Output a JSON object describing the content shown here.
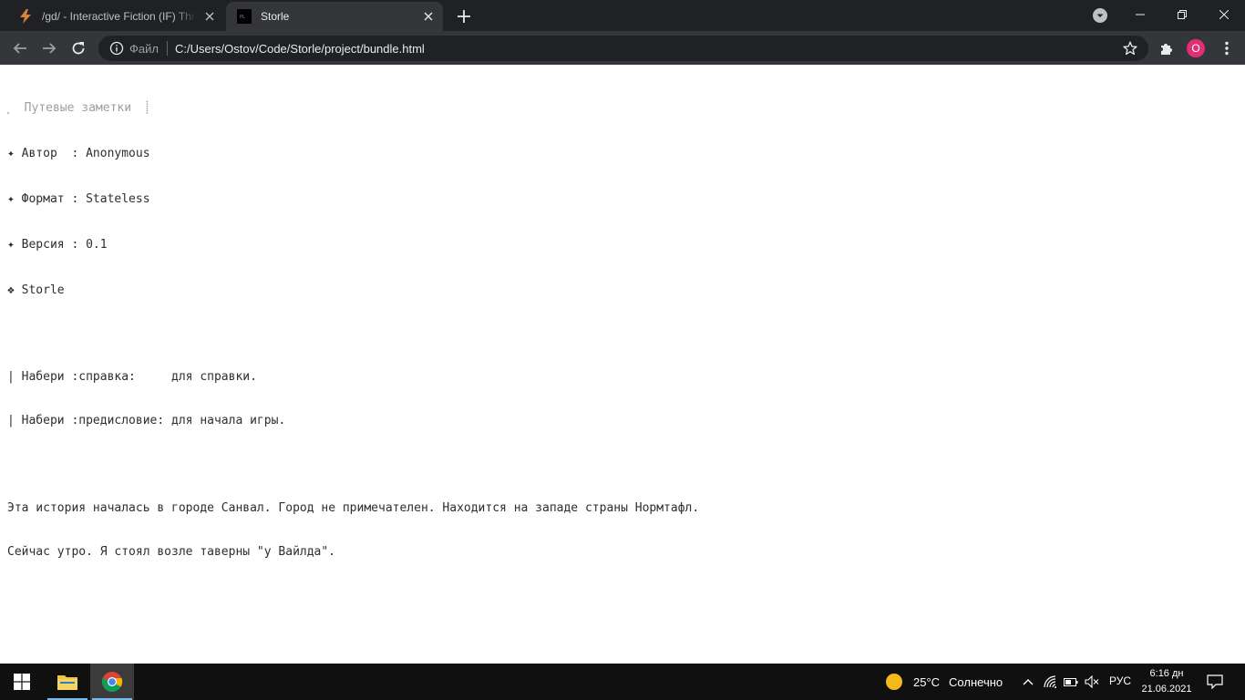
{
  "browser": {
    "tabs": [
      {
        "title": "/gd/ - Interactive Fiction (IF) Thre",
        "favicon": "lightning-icon",
        "active": false
      },
      {
        "title": "Storle",
        "favicon": "terminal-icon",
        "active": true
      }
    ],
    "new_tab_icon": "plus-icon",
    "profile_menu_icon": "chevron-down-icon",
    "window_controls": [
      "minimize-icon",
      "restore-icon",
      "close-icon"
    ],
    "toolbar": {
      "back_icon": "arrow-left-icon",
      "forward_icon": "arrow-right-icon",
      "reload_icon": "reload-icon",
      "scheme_label": "Файл",
      "url": "C:/Users/Ostov/Code/Storle/project/bundle.html",
      "bookmark_icon": "star-icon",
      "extensions_icon": "puzzle-icon",
      "avatar_letter": "O",
      "avatar_color": "#e52f75",
      "menu_icon": "kebab-icon"
    }
  },
  "page": {
    "header_title": "⸼  Путевые заметки  ⸽",
    "meta": [
      "✦ Автор  : Anonymous",
      "✦ Формат : Stateless",
      "✦ Версия : 0.1",
      "❖ Storle"
    ],
    "help": [
      "| Набери :справка:     для справки.",
      "| Набери :предисловие: для начала игры."
    ],
    "story": [
      "Эта история началась в городе Санвал. Город не примечателен. Находится на западе страны Нормтафл.",
      "Сейчас утро. Я стоял возле таверны \"у Вайлда\"."
    ]
  },
  "taskbar": {
    "start_icon": "windows-logo-icon",
    "apps": [
      "folder-icon",
      "chrome-icon"
    ],
    "weather": {
      "temperature": "25°C",
      "condition": "Солнечно",
      "icon": "sun-icon"
    },
    "tray_icons": [
      "chevron-up-icon",
      "wifi-icon",
      "battery-icon",
      "speaker-muted-icon"
    ],
    "language": "РУС",
    "time": "6:16 дн",
    "date": "21.06.2021",
    "notification_icon": "notification-icon"
  }
}
